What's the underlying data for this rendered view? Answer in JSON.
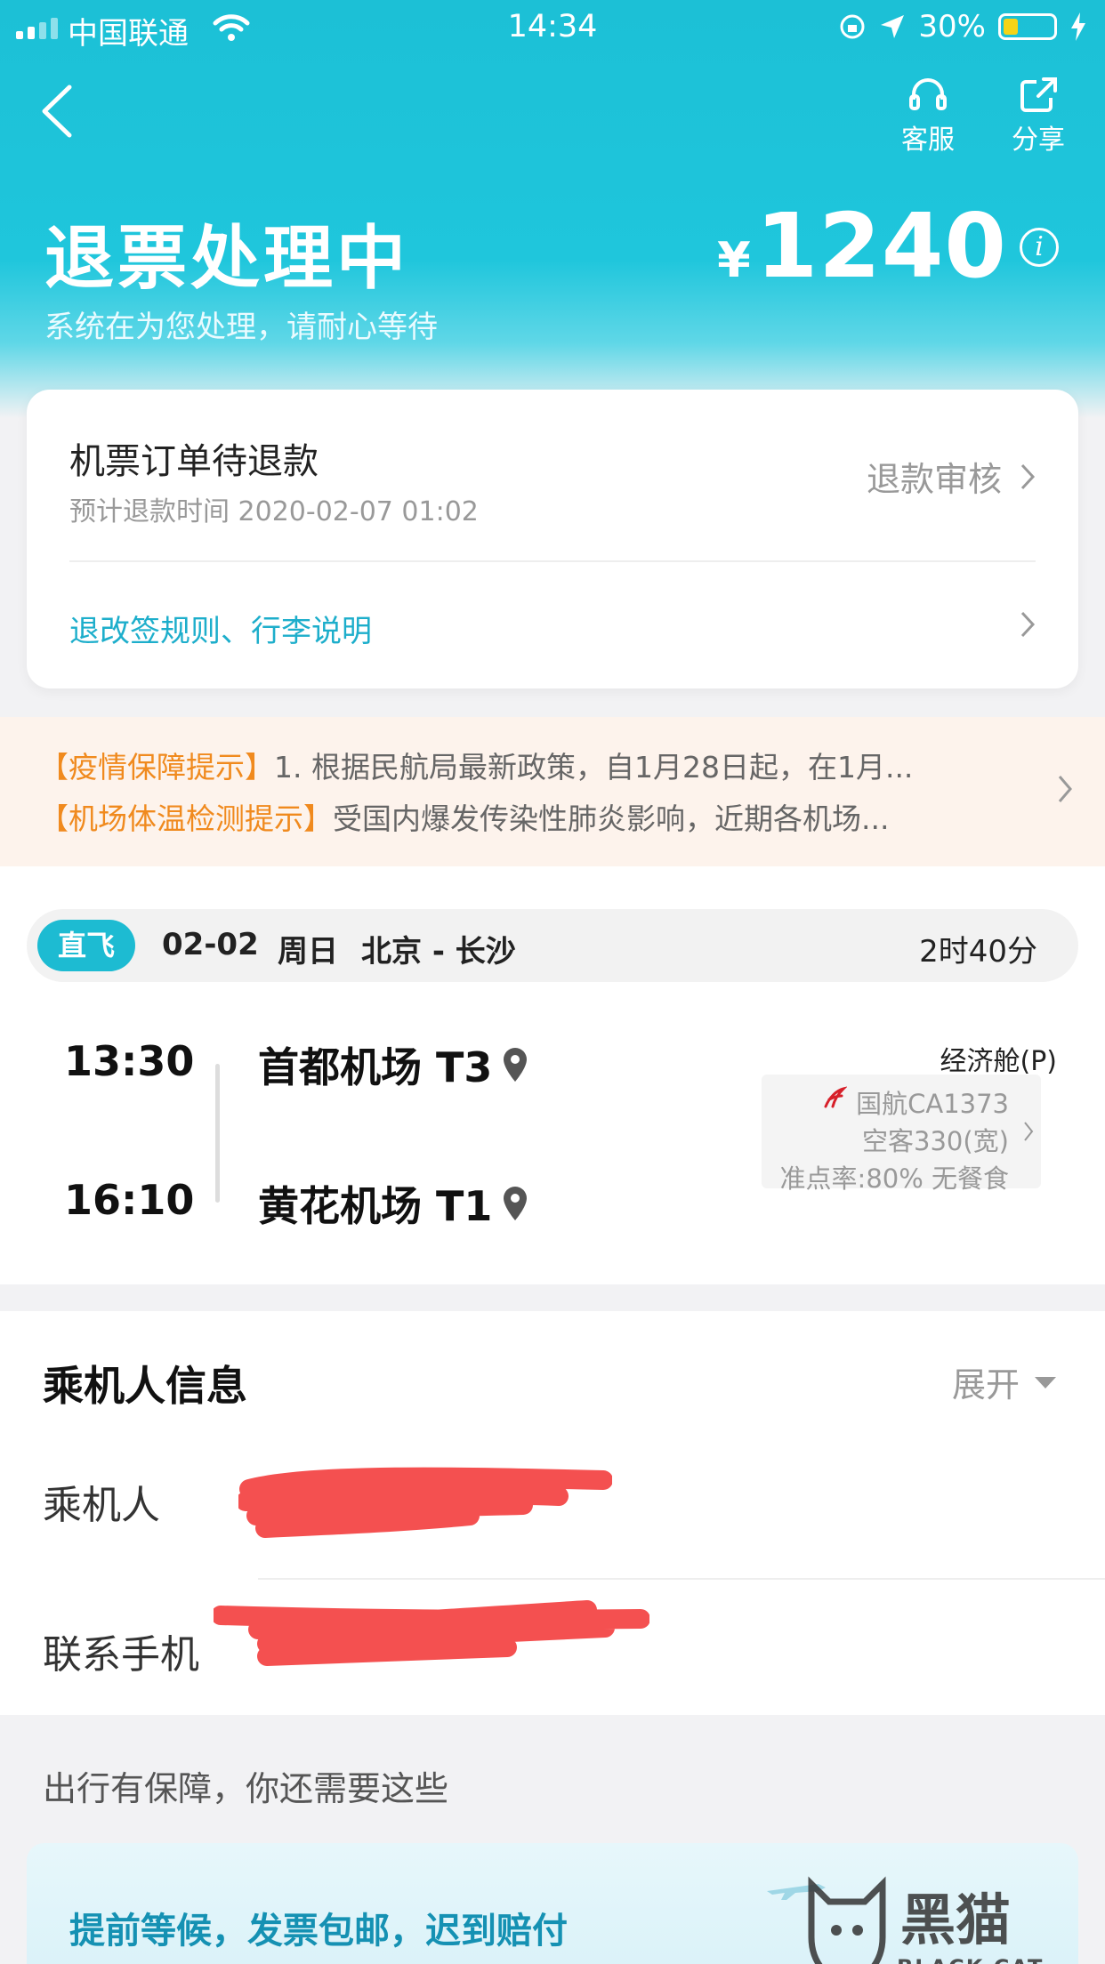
{
  "status_bar": {
    "carrier": "中国联通",
    "time": "14:34",
    "battery": "30%",
    "battery_level": 0.3
  },
  "nav": {
    "service_label": "客服",
    "share_label": "分享"
  },
  "status": {
    "title": "退票处理中",
    "subtitle": "系统在为您处理，请耐心等待",
    "currency": "¥",
    "amount": "1240"
  },
  "refund_card": {
    "title": "机票订单待退款",
    "estimate": "预计退款时间 2020-02-07 01:02",
    "stage": "退款审核",
    "rules_link": "退改签规则、行李说明"
  },
  "notices": [
    {
      "tag": "【疫情保障提示】",
      "text": "1. 根据民航局最新政策，自1月28日起，在1月..."
    },
    {
      "tag": "【机场体温检测提示】",
      "text": "受国内爆发传染性肺炎影响，近期各机场..."
    }
  ],
  "flight": {
    "badge": "直飞",
    "date": "02-02",
    "weekday": "周日",
    "route": "北京 - 长沙",
    "duration": "2时40分",
    "dep_time": "13:30",
    "dep_airport": "首都机场 T3",
    "arr_time": "16:10",
    "arr_airport": "黄花机场 T1",
    "cabin": "经济舱(P)",
    "airline_flight": "国航CA1373",
    "aircraft": "空客330(宽)",
    "punctuality": "准点率:80% 无餐食"
  },
  "passenger": {
    "title": "乘机人信息",
    "expand": "展开",
    "passenger_label": "乘机人",
    "phone_label": "联系手机"
  },
  "promo": {
    "heading": "出行有保障，你还需要这些",
    "card_text": "提前等候，发票包邮，迟到赔付"
  },
  "watermark": {
    "cn": "黑猫",
    "en": "BLACK CAT"
  },
  "colors": {
    "header": "#1fc6dc",
    "accent_link": "#1daecb",
    "notice_tag": "#f08a1e",
    "redaction": "#f45050"
  }
}
